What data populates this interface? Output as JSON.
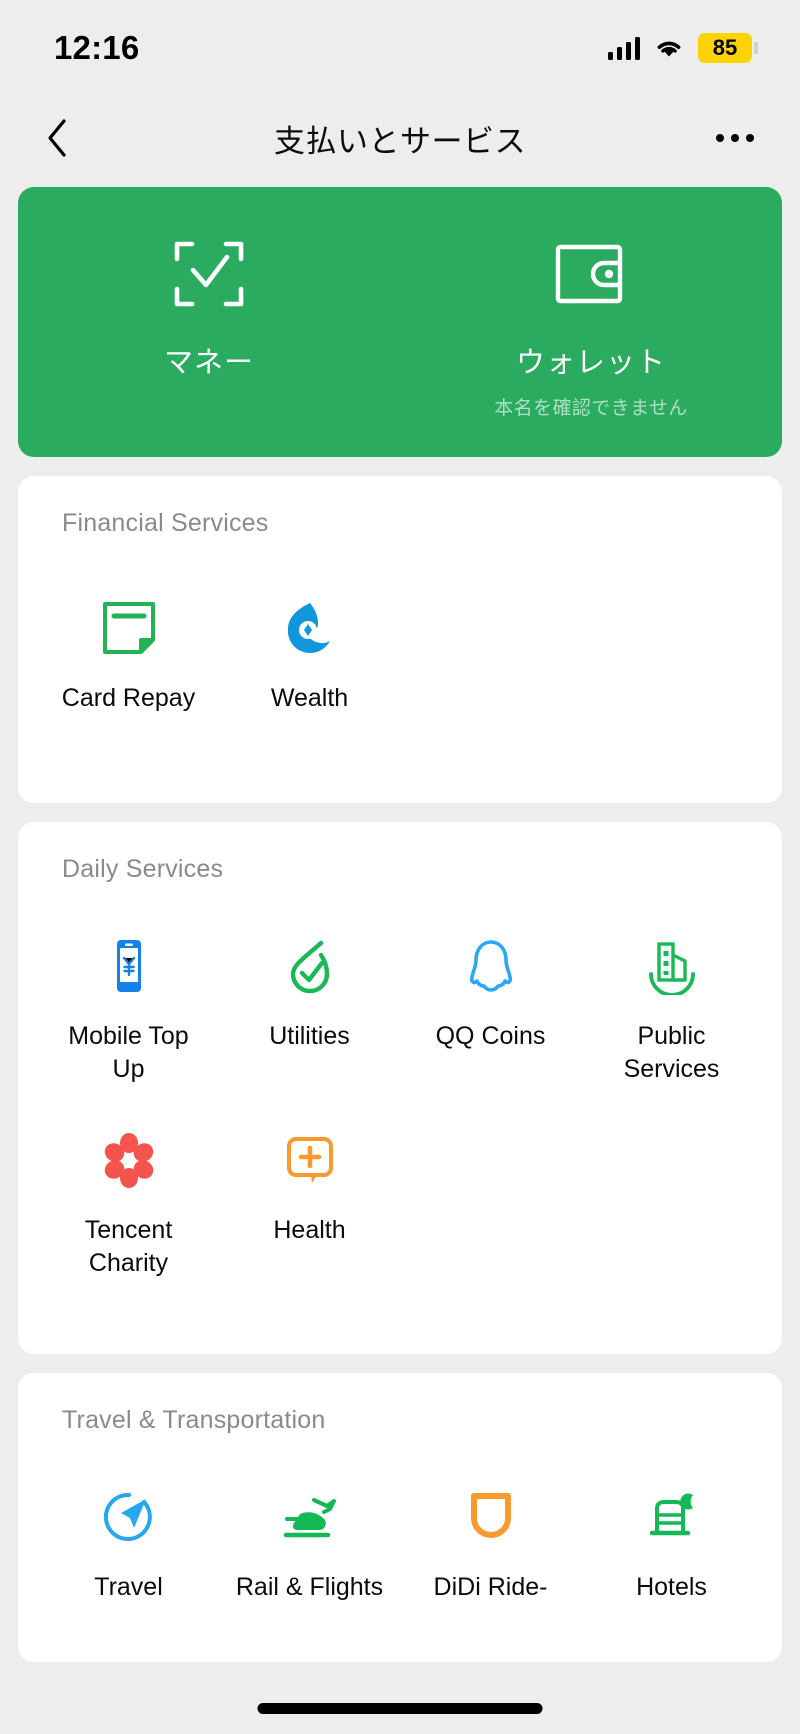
{
  "status_bar": {
    "time": "12:16",
    "battery_level": "85",
    "signal_icon": "cellular-signal-icon",
    "wifi_icon": "wifi-icon",
    "battery_icon": "battery-icon",
    "battery_color": "#fcd307"
  },
  "nav": {
    "back_icon": "chevron-left-icon",
    "title": "支払いとサービス",
    "more_icon": "more-options-icon"
  },
  "hero": {
    "background_color": "#2aab60",
    "items": [
      {
        "label": "マネー",
        "sub": "",
        "icon": "scan-qr-check-icon"
      },
      {
        "label": "ウォレット",
        "sub": "本名を確認できません",
        "icon": "wallet-icon"
      }
    ]
  },
  "sections": [
    {
      "title": "Financial Services",
      "items": [
        {
          "label": "Card Repay",
          "icon": "card-repay-icon",
          "color": "#22b357"
        },
        {
          "label": "Wealth",
          "icon": "wealth-icon",
          "color": "#1296db"
        }
      ]
    },
    {
      "title": "Daily Services",
      "items": [
        {
          "label": "Mobile Top Up",
          "icon": "mobile-topup-icon",
          "color": "#1481e8"
        },
        {
          "label": "Utilities",
          "icon": "utilities-check-icon",
          "color": "#19b955"
        },
        {
          "label": "QQ Coins",
          "icon": "qq-penguin-icon",
          "color": "#28a8f5"
        },
        {
          "label": "Public Services",
          "icon": "public-services-icon",
          "color": "#19b955"
        },
        {
          "label": "Tencent Charity",
          "icon": "charity-flower-icon",
          "color": "#f5534e"
        },
        {
          "label": "Health",
          "icon": "health-plus-icon",
          "color": "#f99a31"
        }
      ]
    },
    {
      "title": "Travel & Transportation",
      "items": [
        {
          "label": "Travel",
          "icon": "travel-compass-icon",
          "color": "#26a7f0"
        },
        {
          "label": "Rail & Flights",
          "icon": "rail-flight-icon",
          "color": "#14b855"
        },
        {
          "label": "DiDi Ride-",
          "icon": "didi-icon",
          "color": "#f79a30"
        },
        {
          "label": "Hotels",
          "icon": "hotel-bed-icon",
          "color": "#14b855"
        }
      ]
    }
  ],
  "home_indicator": "home-indicator"
}
